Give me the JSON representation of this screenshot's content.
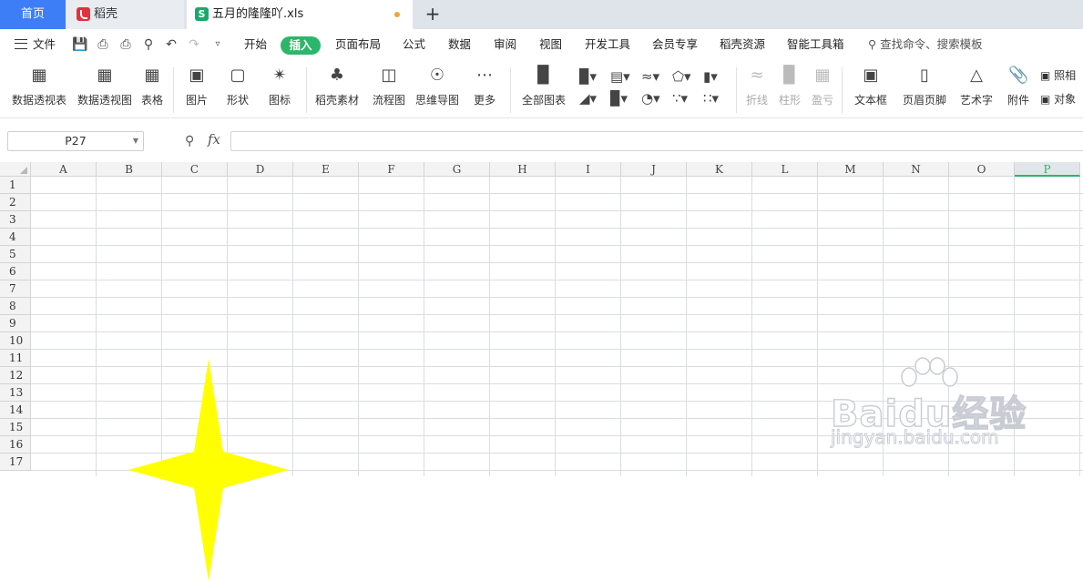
{
  "titlebar": {
    "home_tab": "首页",
    "docer_tab": "稻壳",
    "file_tab": "五月的隆隆吖.xls",
    "file_logo": "S"
  },
  "menubar": {
    "file_menu": "文件",
    "tabs": [
      "开始",
      "插入",
      "页面布局",
      "公式",
      "数据",
      "审阅",
      "视图",
      "开发工具",
      "会员专享",
      "稻壳资源",
      "智能工具箱"
    ],
    "active_tab": "插入",
    "search_placeholder": "查找命令、搜索模板"
  },
  "ribbon": {
    "pivot_table": "数据透视表",
    "pivot_chart": "数据透视图",
    "table": "表格",
    "picture": "图片",
    "shape": "形状",
    "icon": "图标",
    "docer_material": "稻壳素材",
    "flowchart": "流程图",
    "mindmap": "思维导图",
    "more": "更多",
    "all_charts": "全部图表",
    "sparkline_line": "折线",
    "sparkline_column": "柱形",
    "sparkline_winloss": "盈亏",
    "textbox": "文本框",
    "header_footer": "页眉页脚",
    "wordart": "艺术字",
    "attachment": "附件",
    "camera": "照相",
    "object": "对象"
  },
  "formula": {
    "name_box": "P27",
    "fx": "fx",
    "content": ""
  },
  "sheet": {
    "columns": [
      "A",
      "B",
      "C",
      "D",
      "E",
      "F",
      "G",
      "H",
      "I",
      "J",
      "K",
      "L",
      "M",
      "N",
      "O",
      "P"
    ],
    "selected_column": "P",
    "rows": [
      "1",
      "2",
      "3",
      "4",
      "5",
      "6",
      "7",
      "8",
      "9",
      "10",
      "11",
      "12",
      "13",
      "14",
      "15",
      "16",
      "17"
    ],
    "shape": {
      "type": "4-point star",
      "fill": "#ffff00"
    }
  },
  "watermark": {
    "brand": "Baidu经验",
    "url": "jingyan.baidu.com"
  },
  "colors": {
    "accent_blue": "#3d7ef7",
    "accent_green": "#2cb669",
    "docer_red": "#e0333d"
  }
}
